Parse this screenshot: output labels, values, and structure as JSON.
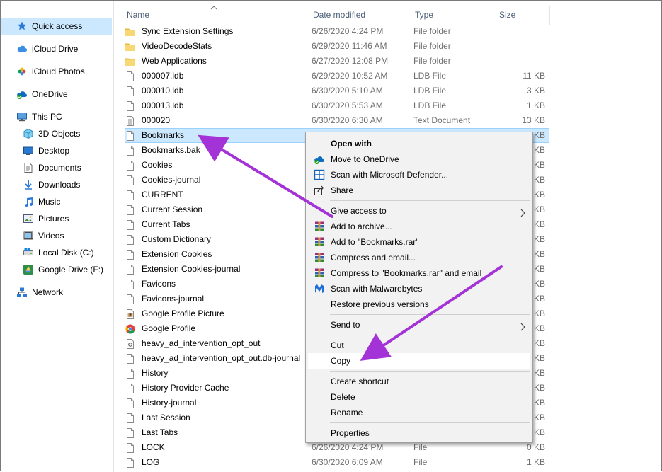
{
  "nav": {
    "items": [
      {
        "label": "Quick access",
        "icon": "star-icon"
      },
      {
        "label": "iCloud Drive",
        "icon": "cloud-icon"
      },
      {
        "label": "iCloud Photos",
        "icon": "photos-icon"
      },
      {
        "label": "OneDrive",
        "icon": "onedrive-icon"
      },
      {
        "label": "This PC",
        "icon": "pc-icon"
      },
      {
        "label": "3D Objects",
        "icon": "cube-icon"
      },
      {
        "label": "Desktop",
        "icon": "desktop-icon"
      },
      {
        "label": "Documents",
        "icon": "documents-icon"
      },
      {
        "label": "Downloads",
        "icon": "download-icon"
      },
      {
        "label": "Music",
        "icon": "music-icon"
      },
      {
        "label": "Pictures",
        "icon": "pictures-icon"
      },
      {
        "label": "Videos",
        "icon": "videos-icon"
      },
      {
        "label": "Local Disk (C:)",
        "icon": "disk-icon"
      },
      {
        "label": "Google Drive (F:)",
        "icon": "google-drive-icon"
      },
      {
        "label": "Network",
        "icon": "network-icon"
      }
    ]
  },
  "columns": {
    "name": "Name",
    "date": "Date modified",
    "type": "Type",
    "size": "Size"
  },
  "files": [
    {
      "name": "Sync Extension Settings",
      "date": "6/26/2020 4:24 PM",
      "type": "File folder",
      "size": "",
      "icon": "folder-icon"
    },
    {
      "name": "VideoDecodeStats",
      "date": "6/29/2020 11:46 AM",
      "type": "File folder",
      "size": "",
      "icon": "folder-icon"
    },
    {
      "name": "Web Applications",
      "date": "6/27/2020 12:08 PM",
      "type": "File folder",
      "size": "",
      "icon": "folder-icon"
    },
    {
      "name": "000007.ldb",
      "date": "6/29/2020 10:52 AM",
      "type": "LDB File",
      "size": "11 KB",
      "icon": "file-icon"
    },
    {
      "name": "000010.ldb",
      "date": "6/30/2020 5:10 AM",
      "type": "LDB File",
      "size": "3 KB",
      "icon": "file-icon"
    },
    {
      "name": "000013.ldb",
      "date": "6/30/2020 5:53 AM",
      "type": "LDB File",
      "size": "1 KB",
      "icon": "file-icon"
    },
    {
      "name": "000020",
      "date": "6/30/2020 6:30 AM",
      "type": "Text Document",
      "size": "13 KB",
      "icon": "text-file-icon"
    },
    {
      "name": "Bookmarks",
      "date": "",
      "type": "",
      "size": "KB",
      "icon": "file-icon"
    },
    {
      "name": "Bookmarks.bak",
      "date": "",
      "type": "",
      "size": "KB",
      "icon": "file-icon"
    },
    {
      "name": "Cookies",
      "date": "",
      "type": "",
      "size": "KB",
      "icon": "file-icon"
    },
    {
      "name": "Cookies-journal",
      "date": "",
      "type": "",
      "size": "KB",
      "icon": "file-icon"
    },
    {
      "name": "CURRENT",
      "date": "",
      "type": "",
      "size": "KB",
      "icon": "file-icon"
    },
    {
      "name": "Current Session",
      "date": "",
      "type": "",
      "size": "KB",
      "icon": "file-icon"
    },
    {
      "name": "Current Tabs",
      "date": "",
      "type": "",
      "size": "KB",
      "icon": "file-icon"
    },
    {
      "name": "Custom Dictionary",
      "date": "",
      "type": "",
      "size": "KB",
      "icon": "file-icon"
    },
    {
      "name": "Extension Cookies",
      "date": "",
      "type": "",
      "size": "KB",
      "icon": "file-icon"
    },
    {
      "name": "Extension Cookies-journal",
      "date": "",
      "type": "",
      "size": "KB",
      "icon": "file-icon"
    },
    {
      "name": "Favicons",
      "date": "",
      "type": "",
      "size": "KB",
      "icon": "file-icon"
    },
    {
      "name": "Favicons-journal",
      "date": "",
      "type": "",
      "size": "KB",
      "icon": "file-icon"
    },
    {
      "name": "Google Profile Picture",
      "date": "",
      "type": "",
      "size": "KB",
      "icon": "image-file-icon"
    },
    {
      "name": "Google Profile",
      "date": "",
      "type": "",
      "size": "KB",
      "icon": "chrome-icon"
    },
    {
      "name": "heavy_ad_intervention_opt_out",
      "date": "",
      "type": "",
      "size": "KB",
      "icon": "settings-file-icon"
    },
    {
      "name": "heavy_ad_intervention_opt_out.db-journal",
      "date": "",
      "type": "",
      "size": "KB",
      "icon": "file-icon"
    },
    {
      "name": "History",
      "date": "",
      "type": "",
      "size": "KB",
      "icon": "file-icon"
    },
    {
      "name": "History Provider Cache",
      "date": "",
      "type": "",
      "size": "KB",
      "icon": "file-icon"
    },
    {
      "name": "History-journal",
      "date": "",
      "type": "",
      "size": "KB",
      "icon": "file-icon"
    },
    {
      "name": "Last Session",
      "date": "",
      "type": "",
      "size": "KB",
      "icon": "file-icon"
    },
    {
      "name": "Last Tabs",
      "date": "",
      "type": "",
      "size": "KB",
      "icon": "file-icon"
    },
    {
      "name": "LOCK",
      "date": "6/26/2020 4:24 PM",
      "type": "File",
      "size": "0 KB",
      "icon": "file-icon"
    },
    {
      "name": "LOG",
      "date": "6/30/2020 6:09 AM",
      "type": "File",
      "size": "1 KB",
      "icon": "file-icon"
    }
  ],
  "selected_file": "Bookmarks",
  "context_menu": {
    "items": [
      {
        "label": "Open with",
        "icon": "",
        "bold": true
      },
      {
        "label": "Move to OneDrive",
        "icon": "onedrive-icon"
      },
      {
        "label": "Scan with Microsoft Defender...",
        "icon": "defender-icon"
      },
      {
        "label": "Share",
        "icon": "share-icon"
      },
      {
        "label": "Give access to",
        "icon": "",
        "submenu": true
      },
      {
        "label": "Add to archive...",
        "icon": "winrar-icon"
      },
      {
        "label": "Add to \"Bookmarks.rar\"",
        "icon": "winrar-icon"
      },
      {
        "label": "Compress and email...",
        "icon": "winrar-icon"
      },
      {
        "label": "Compress to \"Bookmarks.rar\" and email",
        "icon": "winrar-icon"
      },
      {
        "label": "Scan with Malwarebytes",
        "icon": "malwarebytes-icon"
      },
      {
        "label": "Restore previous versions",
        "icon": ""
      },
      {
        "label": "Send to",
        "icon": "",
        "submenu": true
      },
      {
        "label": "Cut",
        "icon": ""
      },
      {
        "label": "Copy",
        "icon": "",
        "highlighted": true
      },
      {
        "label": "Create shortcut",
        "icon": ""
      },
      {
        "label": "Delete",
        "icon": ""
      },
      {
        "label": "Rename",
        "icon": ""
      },
      {
        "label": "Properties",
        "icon": ""
      }
    ]
  },
  "colors": {
    "selection": "#cce8ff",
    "annotation_arrow": "#a333d6",
    "header_text": "#4c607a",
    "folder": "#f8d775"
  }
}
